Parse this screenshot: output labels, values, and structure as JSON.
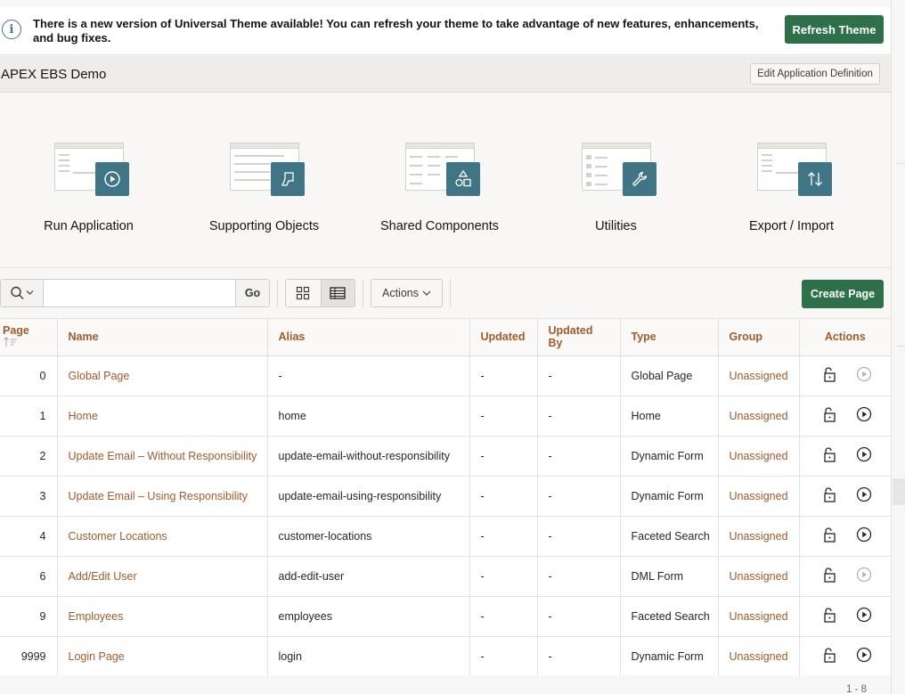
{
  "banner": {
    "message": "There is a new version of Universal Theme available! You can refresh your theme to take advantage of new features, enhancements, and bug fixes.",
    "refresh_label": "Refresh Theme"
  },
  "app": {
    "title": "APEX EBS Demo",
    "edit_definition_label": "Edit Application Definition"
  },
  "hero": [
    {
      "label": "Run Application",
      "icon": "play-icon"
    },
    {
      "label": "Supporting Objects",
      "icon": "scroll-icon"
    },
    {
      "label": "Shared Components",
      "icon": "shapes-icon"
    },
    {
      "label": "Utilities",
      "icon": "wrench-icon"
    },
    {
      "label": "Export / Import",
      "icon": "arrows-updown-icon"
    }
  ],
  "toolbar": {
    "search_value": "",
    "search_placeholder": "",
    "go_label": "Go",
    "actions_label": "Actions",
    "create_page_label": "Create Page"
  },
  "table": {
    "columns": [
      "Page",
      "Name",
      "Alias",
      "Updated",
      "Updated By",
      "Type",
      "Group",
      "Actions"
    ],
    "rows": [
      {
        "page": "0",
        "name": "Global Page",
        "alias": "-",
        "updated": "-",
        "updated_by": "-",
        "type": "Global Page",
        "group": "Unassigned",
        "run_enabled": false
      },
      {
        "page": "1",
        "name": "Home",
        "alias": "home",
        "updated": "-",
        "updated_by": "-",
        "type": "Home",
        "group": "Unassigned",
        "run_enabled": true
      },
      {
        "page": "2",
        "name": "Update Email – Without Responsibility",
        "alias": "update-email-without-responsibility",
        "updated": "-",
        "updated_by": "-",
        "type": "Dynamic Form",
        "group": "Unassigned",
        "run_enabled": true
      },
      {
        "page": "3",
        "name": "Update Email – Using Responsibility",
        "alias": "update-email-using-responsibility",
        "updated": "-",
        "updated_by": "-",
        "type": "Dynamic Form",
        "group": "Unassigned",
        "run_enabled": true
      },
      {
        "page": "4",
        "name": "Customer Locations",
        "alias": "customer-locations",
        "updated": "-",
        "updated_by": "-",
        "type": "Faceted Search",
        "group": "Unassigned",
        "run_enabled": true
      },
      {
        "page": "6",
        "name": "Add/Edit User",
        "alias": "add-edit-user",
        "updated": "-",
        "updated_by": "-",
        "type": "DML Form",
        "group": "Unassigned",
        "run_enabled": false
      },
      {
        "page": "9",
        "name": "Employees",
        "alias": "employees",
        "updated": "-",
        "updated_by": "-",
        "type": "Faceted Search",
        "group": "Unassigned",
        "run_enabled": true
      },
      {
        "page": "9999",
        "name": "Login Page",
        "alias": "login",
        "updated": "-",
        "updated_by": "-",
        "type": "Dynamic Form",
        "group": "Unassigned",
        "run_enabled": true
      }
    ]
  },
  "pager": "1 - 8",
  "colors": {
    "accent_green": "#2d7049",
    "link": "#a05b2c",
    "badge": "#3f7585"
  }
}
